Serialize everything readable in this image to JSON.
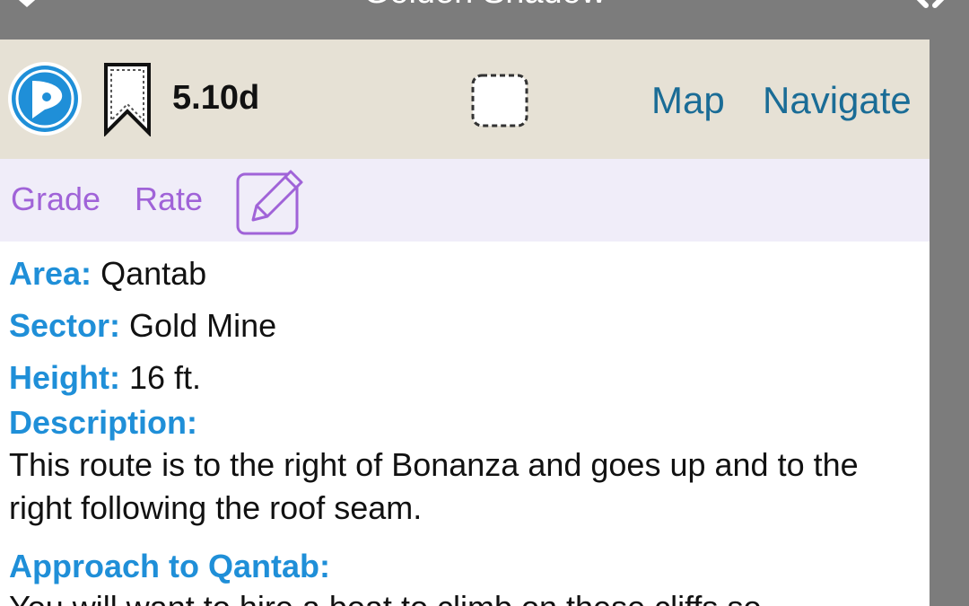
{
  "nav": {
    "title": "Golden Shadow"
  },
  "toolbar": {
    "grade": "5.10d",
    "map_label": "Map",
    "navigate_label": "Navigate"
  },
  "rate_bar": {
    "grade_label": "Grade",
    "rate_label": "Rate"
  },
  "details": {
    "area_label": "Area:",
    "area_value": "Qantab",
    "sector_label": "Sector:",
    "sector_value": "Gold Mine",
    "height_label": "Height:",
    "height_value": "16 ft.",
    "description_label": "Description:",
    "description_text": "This route is to the right of Bonanza and goes up and to the right following the roof seam.",
    "approach_label": "Approach to Qantab:",
    "approach_text": "You will want to hire a boat to climb on these cliffs so"
  },
  "colors": {
    "toolbar_bg": "#e6e1d5",
    "link_blue": "#1a6c96",
    "label_blue": "#1f8fd8",
    "purple": "#a063d8",
    "rate_bg": "#f0edf9"
  },
  "icons": [
    "back-chevron-icon",
    "close-icon",
    "app-logo-icon",
    "bookmark-icon",
    "checkbox-icon",
    "edit-pencil-icon"
  ]
}
